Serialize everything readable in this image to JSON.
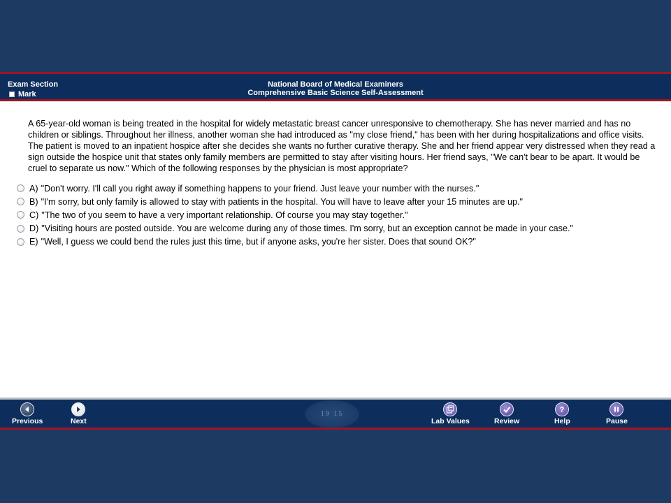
{
  "header": {
    "exam_section": "Exam Section",
    "mark_label": "Mark",
    "org_name": "National Board of Medical Examiners",
    "exam_title": "Comprehensive Basic Science Self-Assessment"
  },
  "question": {
    "stem": "A 65-year-old woman is being treated in the hospital for widely metastatic breast cancer unresponsive to chemotherapy. She has never married and has no children or siblings. Throughout her illness, another woman she had introduced as \"my close friend,\" has been with her during hospitalizations and office visits. The patient is moved to an inpatient hospice after she decides she wants no further curative therapy. She and her friend appear very distressed when they read a sign outside the hospice unit that states only family members are permitted to stay after visiting hours. Her friend says, \"We can't bear to be apart. It would be cruel to separate us now.\" Which of the following responses by the physician is most appropriate?",
    "choices": [
      {
        "letter": "A)",
        "text": "\"Don't worry. I'll call you right away if something happens to your friend. Just leave your number with the nurses.\""
      },
      {
        "letter": "B)",
        "text": "\"I'm sorry, but only family is allowed to stay with patients in the hospital. You will have to leave after your 15 minutes are up.\""
      },
      {
        "letter": "C)",
        "text": "\"The two of you seem to have a very important relationship. Of course you may stay together.\""
      },
      {
        "letter": "D)",
        "text": "\"Visiting hours are posted outside. You are welcome during any of those times. I'm sorry, but an exception cannot be made in your case.\""
      },
      {
        "letter": "E)",
        "text": "\"Well, I guess we could bend the rules just this time, but if anyone asks, you're her sister. Does that sound OK?\""
      }
    ]
  },
  "footer": {
    "previous_label": "Previous",
    "next_label": "Next",
    "lab_values_label": "Lab Values",
    "review_label": "Review",
    "help_label": "Help",
    "pause_label": "Pause",
    "seal_text": "19 15"
  },
  "colors": {
    "background": "#1d3a63",
    "bar_navy": "#0d2e5c",
    "accent_red": "#a01524"
  }
}
